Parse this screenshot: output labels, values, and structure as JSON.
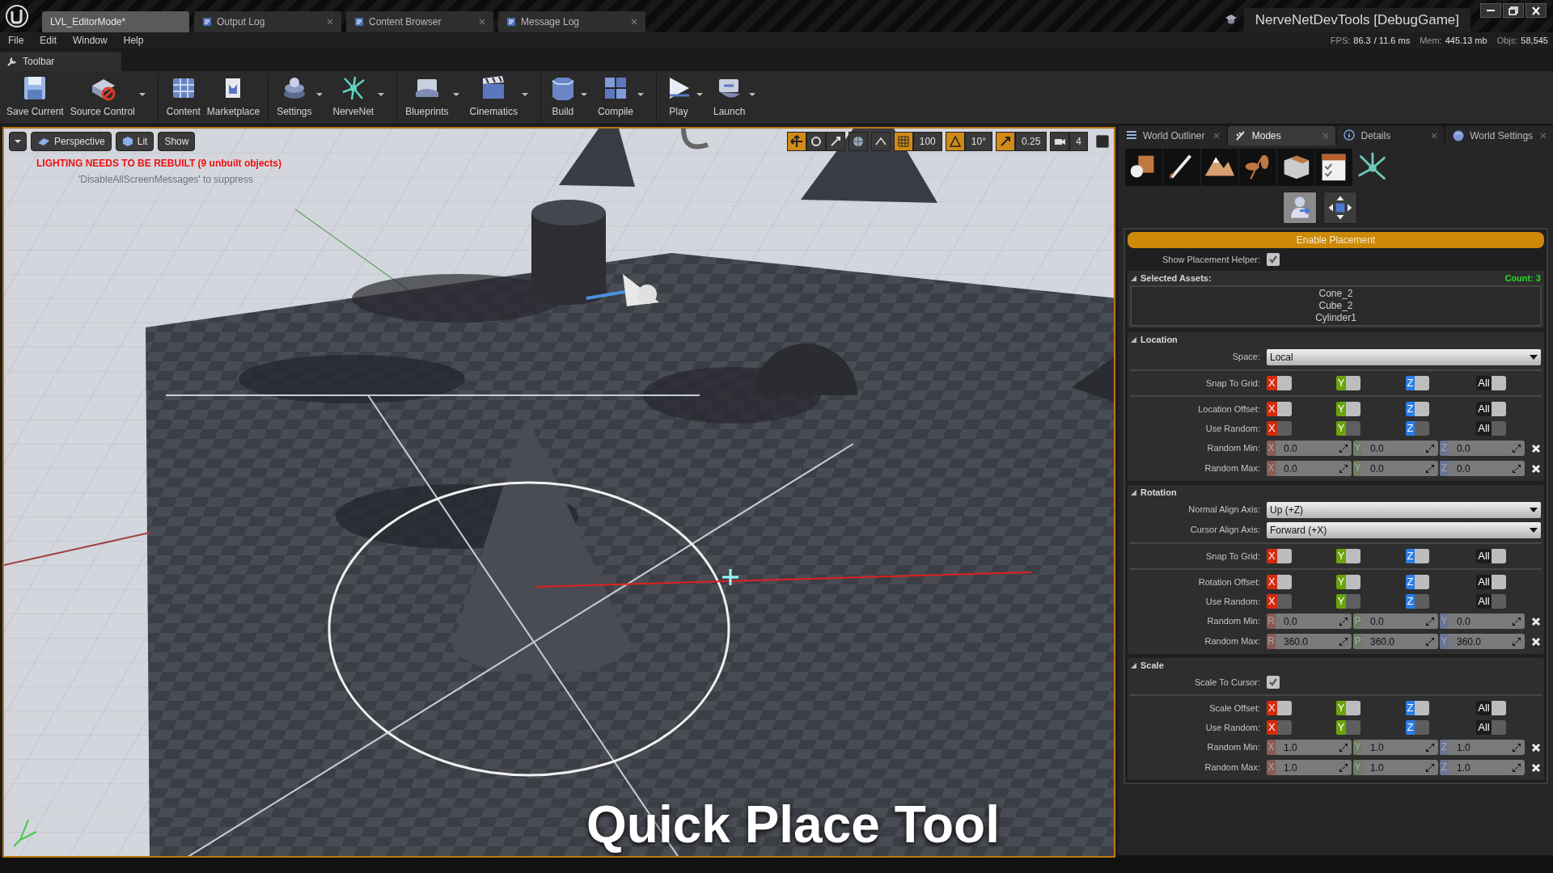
{
  "title_bar": {
    "tabs": [
      {
        "label": "LVL_EditorMode*",
        "selected": true
      },
      {
        "label": "Output Log",
        "selected": false
      },
      {
        "label": "Content Browser",
        "selected": false
      },
      {
        "label": "Message Log",
        "selected": false
      }
    ],
    "project": "NerveNetDevTools [DebugGame]"
  },
  "menu": [
    "File",
    "Edit",
    "Window",
    "Help"
  ],
  "stats": {
    "fps_label": "FPS:",
    "fps": "86.3",
    "ms": "/ 11.6 ms",
    "mem_label": "Mem:",
    "mem": "445.13 mb",
    "objs_label": "Objs:",
    "objs": "58,545"
  },
  "toolbar": {
    "tab": "Toolbar",
    "groups": [
      [
        {
          "label": "Save Current",
          "dropdown": false
        },
        {
          "label": "Source Control",
          "dropdown": true
        }
      ],
      [
        {
          "label": "Content",
          "dropdown": false
        },
        {
          "label": "Marketplace",
          "dropdown": false
        }
      ],
      [
        {
          "label": "Settings",
          "dropdown": true
        },
        {
          "label": "NerveNet",
          "dropdown": true
        }
      ],
      [
        {
          "label": "Blueprints",
          "dropdown": true
        },
        {
          "label": "Cinematics",
          "dropdown": true
        }
      ],
      [
        {
          "label": "Build",
          "dropdown": true
        },
        {
          "label": "Compile",
          "dropdown": true
        }
      ],
      [
        {
          "label": "Play",
          "dropdown": true
        },
        {
          "label": "Launch",
          "dropdown": true
        }
      ]
    ]
  },
  "viewport": {
    "buttons": [
      "Perspective",
      "Lit",
      "Show"
    ],
    "transform_modes": [
      {
        "selected": true
      },
      {
        "selected": false
      },
      {
        "selected": false
      }
    ],
    "grid_snap": "100",
    "rotation_snap": "10°",
    "scale_snap": "0.25",
    "camera_speed": "4",
    "warning": "LIGHTING NEEDS TO BE REBUILT (9 unbuilt objects)",
    "hint": "'DisableAllScreenMessages' to suppress",
    "caption": "Quick Place Tool"
  },
  "panel_tabs": [
    {
      "label": "World Outliner",
      "selected": false
    },
    {
      "label": "Modes",
      "selected": true
    },
    {
      "label": "Details",
      "selected": false
    },
    {
      "label": "World Settings",
      "selected": false
    }
  ],
  "tools": [
    {
      "selected": true
    },
    {
      "selected": false
    }
  ],
  "enable_button": "Enable Placement",
  "show_helper": {
    "label": "Show Placement Helper:",
    "checked": true
  },
  "selected_assets": {
    "title": "Selected Assets:",
    "count": "Count: 3",
    "expanded": true,
    "items": [
      "Cone_2",
      "Cube_2",
      "Cylinder1"
    ]
  },
  "sections": [
    {
      "title": "Location",
      "expanded": true,
      "rows": [
        {
          "kind": "dropdown",
          "label": "Space:",
          "value": "Local"
        },
        {
          "kind": "divider"
        },
        {
          "kind": "axes",
          "label": "Snap To Grid:",
          "disabled": false,
          "axes": [
            {
              "label": "X",
              "color": "#d42a0c",
              "checked": false
            },
            {
              "label": "Y",
              "color": "#6aa30a",
              "checked": false
            },
            {
              "label": "Z",
              "color": "#2a7ee6",
              "checked": false
            },
            {
              "label": "All",
              "color": "#1c1c1c",
              "checked": false
            }
          ]
        },
        {
          "kind": "divider"
        },
        {
          "kind": "axes",
          "label": "Location Offset:",
          "disabled": false,
          "axes": [
            {
              "label": "X",
              "color": "#d42a0c",
              "checked": false
            },
            {
              "label": "Y",
              "color": "#6aa30a",
              "checked": false
            },
            {
              "label": "Z",
              "color": "#2a7ee6",
              "checked": false
            },
            {
              "label": "All",
              "color": "#1c1c1c",
              "checked": false
            }
          ]
        },
        {
          "kind": "axes",
          "label": "Use Random:",
          "disabled": true,
          "axes": [
            {
              "label": "X",
              "color": "#d42a0c",
              "checked": false
            },
            {
              "label": "Y",
              "color": "#6aa30a",
              "checked": false
            },
            {
              "label": "Z",
              "color": "#2a7ee6",
              "checked": false
            },
            {
              "label": "All",
              "color": "#1c1c1c",
              "checked": false
            }
          ]
        },
        {
          "kind": "vector",
          "label": "Random Min:",
          "disabled": true,
          "fields": [
            {
              "axis": "X",
              "color": "#8a5a56",
              "value": "0.0"
            },
            {
              "axis": "Y",
              "color": "#6e7e66",
              "value": "0.0"
            },
            {
              "axis": "Z",
              "color": "#6a7494",
              "value": "0.0"
            }
          ]
        },
        {
          "kind": "vector",
          "label": "Random Max:",
          "disabled": true,
          "fields": [
            {
              "axis": "X",
              "color": "#8a5a56",
              "value": "0.0"
            },
            {
              "axis": "Y",
              "color": "#6e7e66",
              "value": "0.0"
            },
            {
              "axis": "Z",
              "color": "#6a7494",
              "value": "0.0"
            }
          ]
        }
      ]
    },
    {
      "title": "Rotation",
      "expanded": true,
      "rows": [
        {
          "kind": "dropdown",
          "label": "Normal Align Axis:",
          "value": "Up (+Z)"
        },
        {
          "kind": "dropdown",
          "label": "Cursor Align Axis:",
          "value": "Forward (+X)"
        },
        {
          "kind": "divider"
        },
        {
          "kind": "axes",
          "label": "Snap To Grid:",
          "disabled": false,
          "axes": [
            {
              "label": "X",
              "color": "#d42a0c",
              "checked": false
            },
            {
              "label": "Y",
              "color": "#6aa30a",
              "checked": false
            },
            {
              "label": "Z",
              "color": "#2a7ee6",
              "checked": false
            },
            {
              "label": "All",
              "color": "#1c1c1c",
              "checked": false
            }
          ]
        },
        {
          "kind": "divider"
        },
        {
          "kind": "axes",
          "label": "Rotation Offset:",
          "disabled": false,
          "axes": [
            {
              "label": "X",
              "color": "#d42a0c",
              "checked": false
            },
            {
              "label": "Y",
              "color": "#6aa30a",
              "checked": false
            },
            {
              "label": "Z",
              "color": "#2a7ee6",
              "checked": false
            },
            {
              "label": "All",
              "color": "#1c1c1c",
              "checked": false
            }
          ]
        },
        {
          "kind": "axes",
          "label": "Use Random:",
          "disabled": true,
          "axes": [
            {
              "label": "X",
              "color": "#d42a0c",
              "checked": false
            },
            {
              "label": "Y",
              "color": "#6aa30a",
              "checked": false
            },
            {
              "label": "Z",
              "color": "#2a7ee6",
              "checked": false
            },
            {
              "label": "All",
              "color": "#1c1c1c",
              "checked": false
            }
          ]
        },
        {
          "kind": "vector",
          "label": "Random Min:",
          "disabled": true,
          "fields": [
            {
              "axis": "R",
              "color": "#8a5a56",
              "value": "0.0"
            },
            {
              "axis": "P",
              "color": "#6e7e66",
              "value": "0.0"
            },
            {
              "axis": "Y",
              "color": "#6a7494",
              "value": "0.0"
            }
          ]
        },
        {
          "kind": "vector",
          "label": "Random Max:",
          "disabled": true,
          "fields": [
            {
              "axis": "R",
              "color": "#8a5a56",
              "value": "360.0"
            },
            {
              "axis": "P",
              "color": "#6e7e66",
              "value": "360.0"
            },
            {
              "axis": "Y",
              "color": "#6a7494",
              "value": "360.0"
            }
          ]
        }
      ]
    },
    {
      "title": "Scale",
      "expanded": true,
      "rows": [
        {
          "kind": "checkbox",
          "label": "Scale To Cursor:",
          "checked": true
        },
        {
          "kind": "divider"
        },
        {
          "kind": "axes",
          "label": "Scale Offset:",
          "disabled": false,
          "axes": [
            {
              "label": "X",
              "color": "#d42a0c",
              "checked": false
            },
            {
              "label": "Y",
              "color": "#6aa30a",
              "checked": false
            },
            {
              "label": "Z",
              "color": "#2a7ee6",
              "checked": false
            },
            {
              "label": "All",
              "color": "#1c1c1c",
              "checked": false
            }
          ]
        },
        {
          "kind": "axes",
          "label": "Use Random:",
          "disabled": true,
          "axes": [
            {
              "label": "X",
              "color": "#d42a0c",
              "checked": false
            },
            {
              "label": "Y",
              "color": "#6aa30a",
              "checked": false
            },
            {
              "label": "Z",
              "color": "#2a7ee6",
              "checked": false
            },
            {
              "label": "All",
              "color": "#1c1c1c",
              "checked": false
            }
          ]
        },
        {
          "kind": "vector",
          "label": "Random Min:",
          "disabled": true,
          "fields": [
            {
              "axis": "X",
              "color": "#8a5a56",
              "value": "1.0"
            },
            {
              "axis": "Y",
              "color": "#6e7e66",
              "value": "1.0"
            },
            {
              "axis": "Z",
              "color": "#6a7494",
              "value": "1.0"
            }
          ]
        },
        {
          "kind": "vector",
          "label": "Random Max:",
          "disabled": true,
          "fields": [
            {
              "axis": "X",
              "color": "#8a5a56",
              "value": "1.0"
            },
            {
              "axis": "Y",
              "color": "#6e7e66",
              "value": "1.0"
            },
            {
              "axis": "Z",
              "color": "#6a7494",
              "value": "1.0"
            }
          ]
        }
      ]
    }
  ]
}
